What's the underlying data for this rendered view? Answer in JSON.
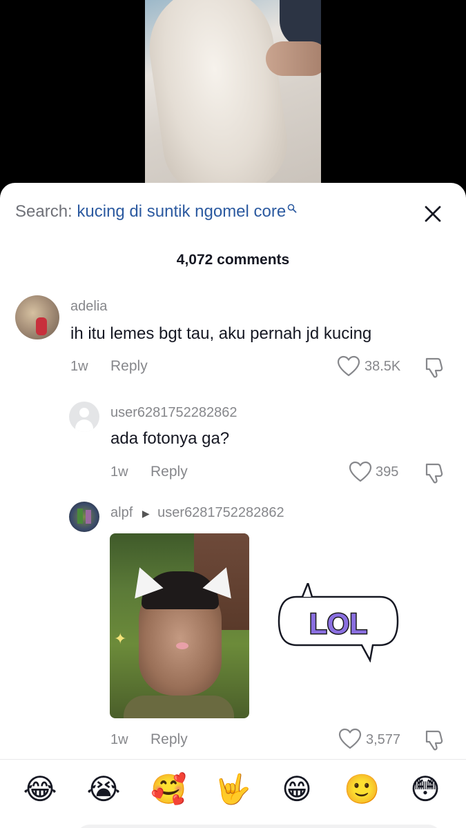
{
  "search": {
    "prefix": "Search:",
    "query": "kucing di suntik ngomel core"
  },
  "comments_header": {
    "count_label": "4,072 comments"
  },
  "comments": [
    {
      "username": "adelia",
      "text": "ih itu lemes bgt tau, aku pernah jd kucing",
      "time": "1w",
      "reply_label": "Reply",
      "likes": "38.5K"
    },
    {
      "username": "user6281752282862",
      "text": "ada fotonya ga?",
      "time": "1w",
      "reply_label": "Reply",
      "likes": "395"
    },
    {
      "username": "alpf",
      "reply_to": "user6281752282862",
      "sticker_text": "LOL",
      "time": "1w",
      "reply_label": "Reply",
      "likes": "3,577"
    }
  ],
  "emoji_bar": [
    "😂",
    "😭",
    "🥰",
    "🤟",
    "😁",
    "🙂",
    "😳"
  ],
  "colors": {
    "accent_link": "#2c5aa0",
    "muted_text": "#86878b",
    "sheet_bg": "#ffffff",
    "video_bg": "#000000"
  }
}
